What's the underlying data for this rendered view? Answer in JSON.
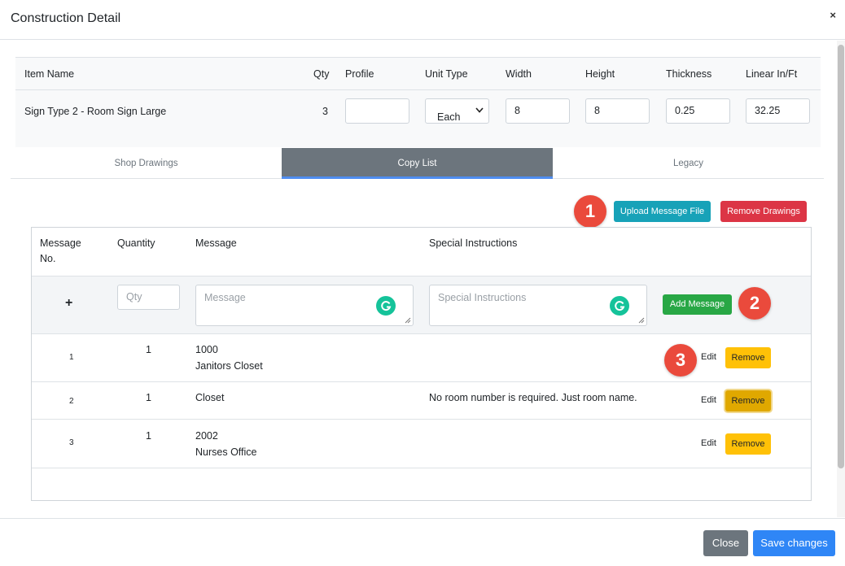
{
  "modal": {
    "title": "Construction Detail",
    "close_glyph": "×"
  },
  "item_table": {
    "headers": [
      "Item Name",
      "Qty",
      "Profile",
      "Unit Type",
      "Width",
      "Height",
      "Thickness",
      "Linear In/Ft"
    ],
    "row": {
      "item_name": "Sign Type 2 - Room Sign Large",
      "qty": "3",
      "profile": "",
      "unit_type": "Each",
      "width": "8",
      "height": "8",
      "thickness": "0.25",
      "linear": "32.25"
    }
  },
  "tabs": [
    {
      "label": "Shop Drawings",
      "active": false
    },
    {
      "label": "Copy List",
      "active": true
    },
    {
      "label": "Legacy",
      "active": false
    }
  ],
  "actions": {
    "upload_label": "Upload Message File",
    "remove_drawings_label": "Remove Drawings",
    "add_message_label": "Add Message"
  },
  "callouts": [
    "1",
    "2",
    "3"
  ],
  "message_table": {
    "headers": {
      "message_no_line1": "Message",
      "message_no_line2": "No.",
      "quantity": "Quantity",
      "message": "Message",
      "special": "Special Instructions"
    },
    "add_row": {
      "plus": "+",
      "qty_placeholder": "Qty",
      "message_placeholder": "Message",
      "special_placeholder": "Special Instructions"
    },
    "rows": [
      {
        "no": "1",
        "qty": "1",
        "message_line1": "1000",
        "message_line2": "Janitors Closet",
        "special": "",
        "edit": "Edit",
        "remove": "Remove"
      },
      {
        "no": "2",
        "qty": "1",
        "message_line1": "Closet",
        "message_line2": "",
        "special": "No room number is required. Just room name.",
        "edit": "Edit",
        "remove": "Remove"
      },
      {
        "no": "3",
        "qty": "1",
        "message_line1": "2002",
        "message_line2": "Nurses Office",
        "special": "",
        "edit": "Edit",
        "remove": "Remove"
      }
    ]
  },
  "footer": {
    "close_label": "Close",
    "save_label": "Save changes"
  },
  "colors": {
    "info": "#17a2b8",
    "danger": "#dc3545",
    "success": "#28a745",
    "warning": "#ffc107",
    "secondary": "#6c757d",
    "primary": "#2f86f6",
    "callout": "#ea4a3c",
    "grammarly": "#15c39a"
  }
}
